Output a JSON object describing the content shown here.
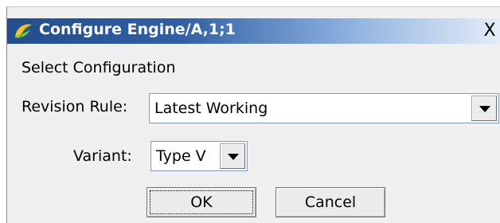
{
  "window": {
    "title": "Configure Engine/A,1;1",
    "close_glyph": "X",
    "icon": "teamcenter-logo-icon"
  },
  "section": {
    "label": "Select Configuration"
  },
  "revision_rule": {
    "label": "Revision Rule:",
    "value": "Latest Working"
  },
  "variant": {
    "label": "Variant:",
    "value": "Type V"
  },
  "buttons": {
    "ok": "OK",
    "cancel": "Cancel"
  },
  "colors": {
    "titlebar_start": "#244e8c",
    "titlebar_end": "#e4edf8",
    "dialog_bg": "#f0f0f0"
  }
}
